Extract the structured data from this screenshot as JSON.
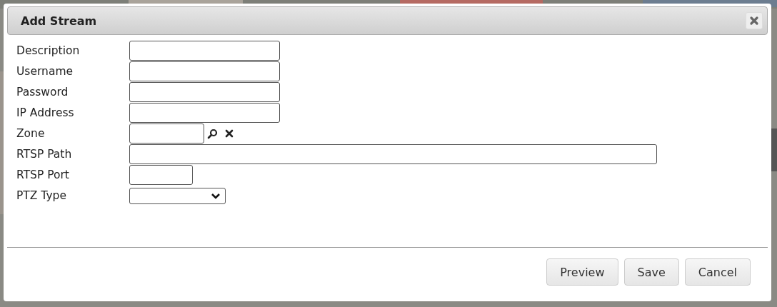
{
  "dialog": {
    "title": "Add Stream"
  },
  "fields": [
    {
      "label": "Description",
      "kind": "text"
    },
    {
      "label": "Username",
      "kind": "text"
    },
    {
      "label": "Password",
      "kind": "text"
    },
    {
      "label": "IP Address",
      "kind": "text"
    },
    {
      "label": "Zone",
      "kind": "lookup"
    },
    {
      "label": "RTSP Path",
      "kind": "wide"
    },
    {
      "label": "RTSP Port",
      "kind": "short"
    },
    {
      "label": "PTZ Type",
      "kind": "select"
    }
  ],
  "buttons": [
    "Preview",
    "Save",
    "Cancel"
  ]
}
